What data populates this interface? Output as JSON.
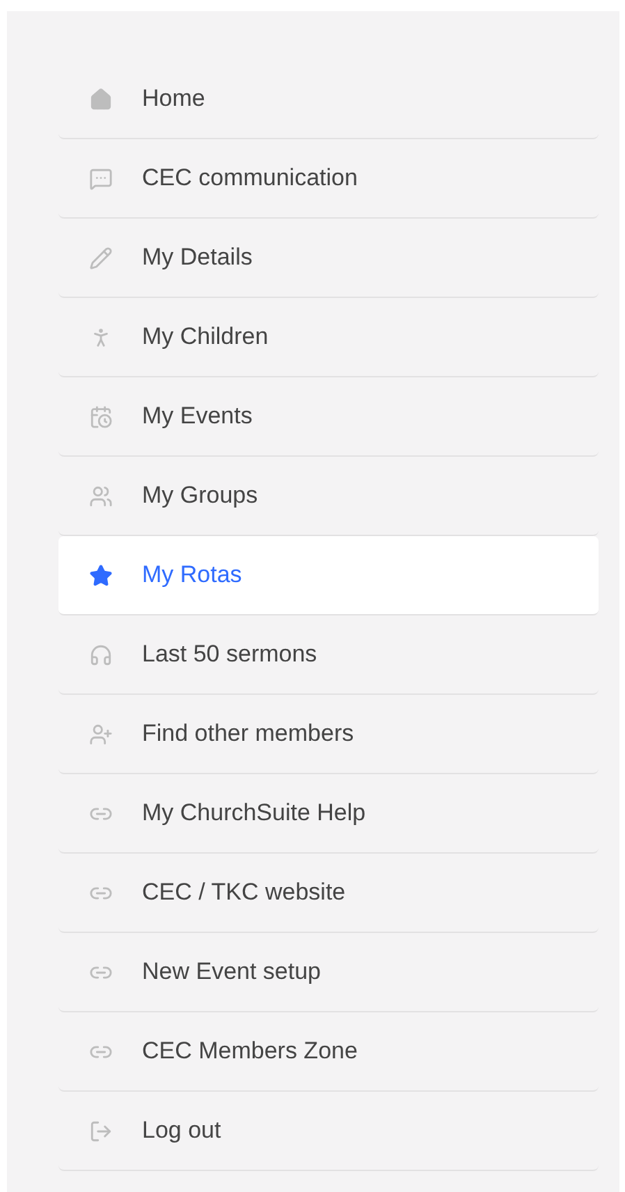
{
  "menu": {
    "items": [
      {
        "label": "Home",
        "selected": false
      },
      {
        "label": "CEC communication",
        "selected": false
      },
      {
        "label": "My Details",
        "selected": false
      },
      {
        "label": "My Children",
        "selected": false
      },
      {
        "label": "My Events",
        "selected": false
      },
      {
        "label": "My Groups",
        "selected": false
      },
      {
        "label": "My Rotas",
        "selected": true
      },
      {
        "label": "Last 50 sermons",
        "selected": false
      },
      {
        "label": "Find other members",
        "selected": false
      },
      {
        "label": "My ChurchSuite Help",
        "selected": false
      },
      {
        "label": "CEC / TKC website",
        "selected": false
      },
      {
        "label": "New Event setup",
        "selected": false
      },
      {
        "label": "CEC Members Zone",
        "selected": false
      },
      {
        "label": "Log out",
        "selected": false
      }
    ]
  }
}
